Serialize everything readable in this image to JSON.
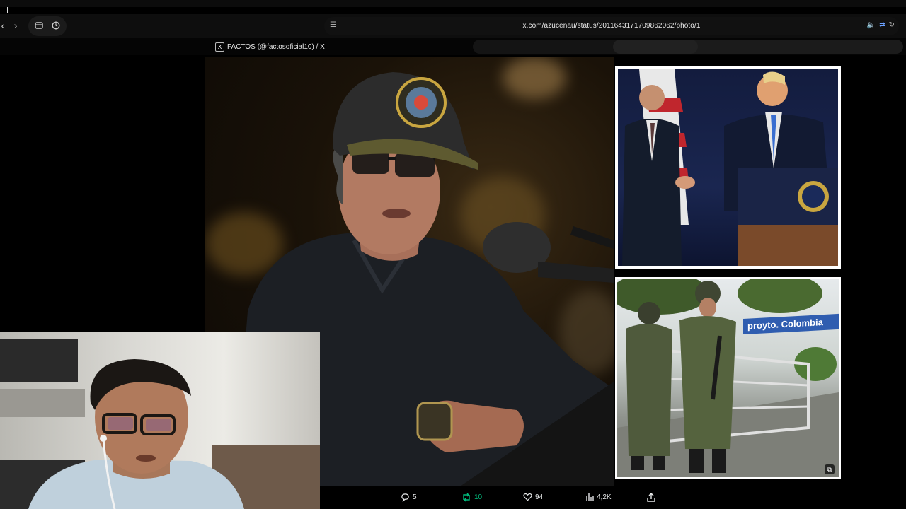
{
  "browser": {
    "url": "x.com/azucenau/status/2011643171709862062/photo/1",
    "tab_title": "FACTOS (@factosoficial10) / X",
    "back_icon": "chevron-left-icon",
    "forward_icon": "chevron-right-icon"
  },
  "post_actions": {
    "replies": "5",
    "reposts": "10",
    "likes": "94",
    "views": "4,2K"
  },
  "photos": {
    "bottom_sign_text": "proyto. Colombia"
  },
  "colors": {
    "background": "#000000",
    "repost_green": "#00ba7c",
    "sign_blue": "#2f5db0"
  }
}
